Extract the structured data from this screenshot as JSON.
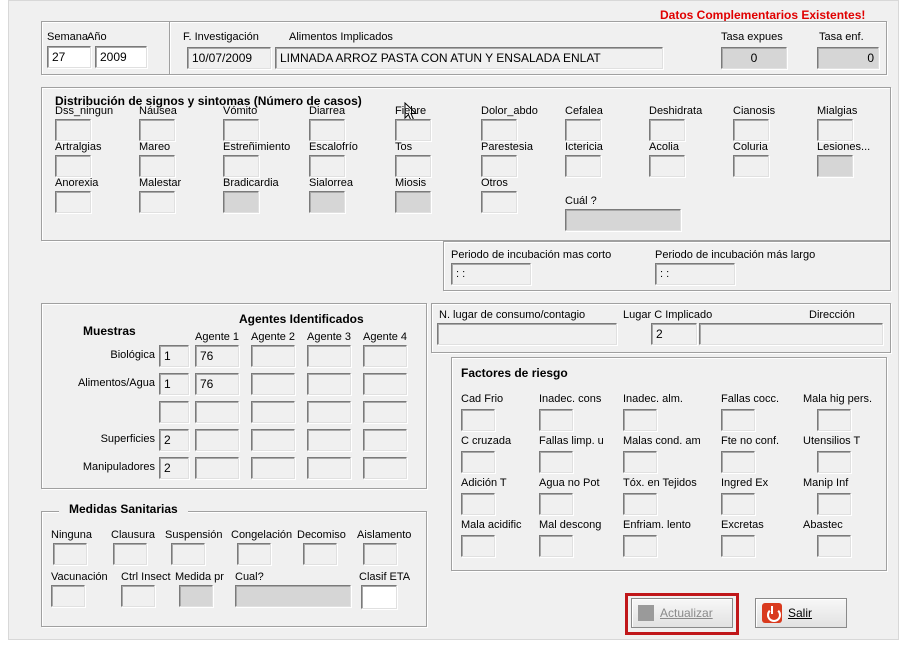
{
  "header": {
    "existentes": "Datos Complementarios Existentes!"
  },
  "top": {
    "semana_label": "Semana",
    "anio_label": "Año",
    "semana": "27",
    "anio": "2009",
    "finv_label": "F. Investigación",
    "finv": "10/07/2009",
    "alimentos_label": "Alimentos Implicados",
    "alimentos": "LIMNADA ARROZ PASTA CON  ATUN Y ENSALADA ENLAT",
    "tasa_exp_label": "Tasa expues",
    "tasa_exp": "0",
    "tasa_enf_label": "Tasa enf.",
    "tasa_enf": "0"
  },
  "sintomas": {
    "title": "Distribución de signos y sintomas (Número de casos)",
    "row1": [
      "Dss_ningun",
      "Náusea",
      "Vómito",
      "Diarrea",
      "Fiebre",
      "Dolor_abdo",
      "Cefalea",
      "Deshidrata",
      "Cianosis",
      "Mialgias"
    ],
    "row2": [
      "Artralgias",
      "Mareo",
      "Estreñimiento",
      "Escalofrío",
      "Tos",
      "Parestesia",
      "Ictericia",
      "Acolia",
      "Coluria",
      "Lesiones..."
    ],
    "row3": [
      "Anorexia",
      "Malestar",
      "Bradicardia",
      "Sialorrea",
      "Miosis",
      "Otros"
    ],
    "cual_label": "Cuál ?"
  },
  "incubacion": {
    "corto_label": "Periodo de incubación mas corto",
    "corto": ": :",
    "largo_label": "Periodo de incubación más largo",
    "largo": ": :"
  },
  "agentes": {
    "title": "Agentes Identificados",
    "muestras_title": "Muestras",
    "headers": [
      "Agente 1",
      "Agente 2",
      "Agente 3",
      "Agente 4"
    ],
    "rows": [
      {
        "label": "Biológica",
        "count": "1",
        "a1": "76"
      },
      {
        "label": "Alimentos/Agua",
        "count": "1",
        "a1": "76"
      },
      {
        "label": "",
        "count": "",
        "a1": ""
      },
      {
        "label": "Superficies",
        "count": "2",
        "a1": ""
      },
      {
        "label": "Manipuladores",
        "count": "2",
        "a1": ""
      }
    ]
  },
  "lugar": {
    "nlugar_label": "N. lugar de consumo/contagio",
    "lugarc_label": "Lugar C Implicado",
    "lugarc": "2",
    "direccion_label": "Dirección"
  },
  "riesgo": {
    "title": "Factores de riesgo",
    "row1": [
      "Cad Frio",
      "Inadec. cons",
      "Inadec. alm.",
      "Fallas cocc.",
      "Mala hig pers."
    ],
    "row2": [
      "C cruzada",
      "Fallas limp. u",
      "Malas cond. am",
      "Fte no conf.",
      "Utensilios T"
    ],
    "row3": [
      "Adición T",
      "Agua no Pot",
      "Tóx. en Tejidos",
      "Ingred Ex",
      "Manip Inf"
    ],
    "row4": [
      "Mala acidific",
      "Mal descong",
      "Enfriam. lento",
      "Excretas",
      "Abastec"
    ]
  },
  "medidas": {
    "title": "Medidas Sanitarias",
    "row1": [
      "Ninguna",
      "Clausura",
      "Suspensión",
      "Congelación",
      "Decomiso",
      "Aislamento"
    ],
    "row2": [
      "Vacunación",
      "Ctrl Insect",
      "Medida pr",
      "Cual?"
    ],
    "clasif_label": "Clasif ETA"
  },
  "buttons": {
    "actualizar": "Actualizar",
    "salir": "Salir"
  },
  "icons": {
    "actualizar": "gray-square-icon",
    "salir": "power-icon",
    "cursor": "mouse-pointer-icon"
  },
  "colors": {
    "alert": "#e00000",
    "highlight": "#c0171a"
  }
}
